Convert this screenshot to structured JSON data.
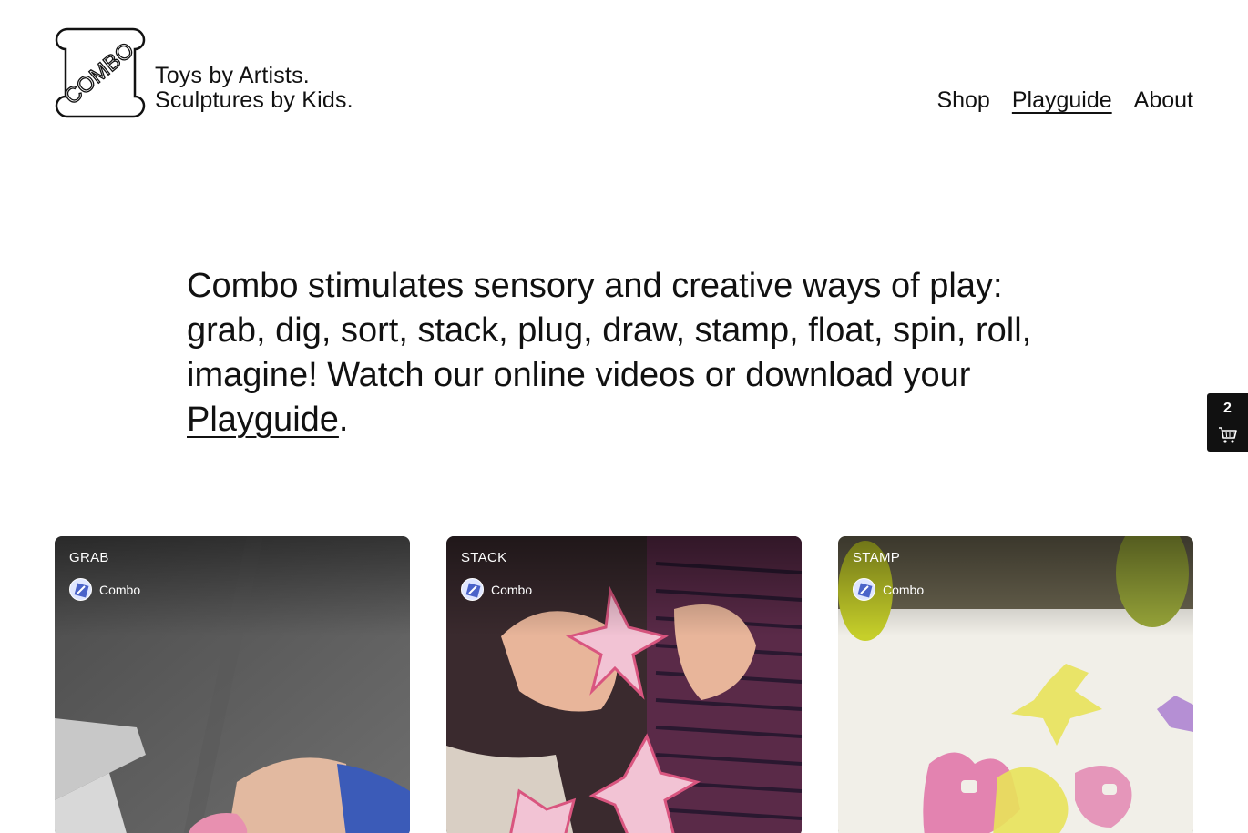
{
  "brand": {
    "logo_text": "COMBO",
    "tagline_line1": "Toys by Artists.",
    "tagline_line2": "Sculptures by Kids."
  },
  "nav": {
    "items": [
      {
        "label": "Shop",
        "active": false
      },
      {
        "label": "Playguide",
        "active": true
      },
      {
        "label": "About",
        "active": false
      }
    ]
  },
  "hero": {
    "text_before_link": "Combo stimulates sensory and creative ways of play: grab, dig, sort, stack, plug, draw, stamp, float, spin, roll, imagine! Watch our online videos or download your ",
    "link_label": "Playguide",
    "text_after_link": "."
  },
  "cart": {
    "count": "2",
    "icon": "cart-icon"
  },
  "videos": [
    {
      "title": "GRAB",
      "channel": "Combo"
    },
    {
      "title": "STACK",
      "channel": "Combo"
    },
    {
      "title": "STAMP",
      "channel": "Combo"
    }
  ],
  "colors": {
    "text": "#111111",
    "background": "#ffffff",
    "cart_bg": "#111111"
  }
}
